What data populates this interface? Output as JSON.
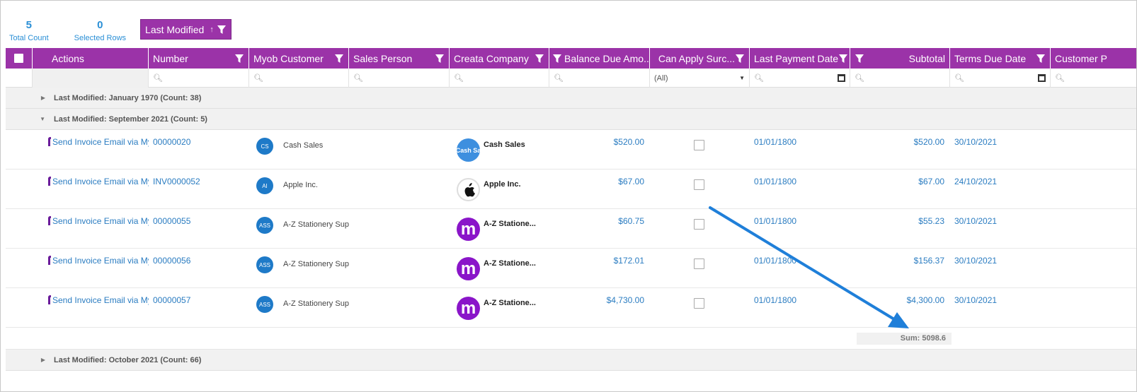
{
  "stats": {
    "total_count": "5",
    "total_count_label": "Total Count",
    "selected_rows": "0",
    "selected_rows_label": "Selected Rows"
  },
  "group_chip": {
    "label": "Last Modified",
    "sort_arrow": "↑"
  },
  "columns": {
    "actions": "Actions",
    "number": "Number",
    "myob_customer": "Myob Customer",
    "sales_person": "Sales Person",
    "creata_company": "Creata Company",
    "balance_due": "Balance Due Amo...",
    "can_apply": "Can Apply Surc...",
    "last_payment": "Last Payment Date",
    "subtotal": "Subtotal",
    "terms_due": "Terms Due Date",
    "customer_p": "Customer P"
  },
  "filters": {
    "can_apply_value": "(All)"
  },
  "groups": {
    "g1970": "Last Modified: January 1970 (Count: 38)",
    "g2021sep": "Last Modified: September 2021 (Count: 5)",
    "g2021oct": "Last Modified: October 2021 (Count: 66)"
  },
  "rows": [
    {
      "action": "Send Invoice Email via My",
      "number": "00000020",
      "cust_initials": "CS",
      "customer": "Cash Sales",
      "company_logo": "Cash Sa",
      "company": "Cash Sales",
      "balance": "$520.00",
      "last_payment": "01/01/1800",
      "subtotal": "$520.00",
      "terms_due": "30/10/2021"
    },
    {
      "action": "Send Invoice Email via My",
      "number": "INV0000052",
      "cust_initials": "AI",
      "customer": "Apple Inc.",
      "company_logo": "",
      "company": "Apple Inc.",
      "balance": "$67.00",
      "last_payment": "01/01/1800",
      "subtotal": "$67.00",
      "terms_due": "24/10/2021"
    },
    {
      "action": "Send Invoice Email via My",
      "number": "00000055",
      "cust_initials": "ASS",
      "customer": "A-Z Stationery Supp",
      "company_logo": "m",
      "company": "A-Z Statione...",
      "balance": "$60.75",
      "last_payment": "01/01/1800",
      "subtotal": "$55.23",
      "terms_due": "30/10/2021"
    },
    {
      "action": "Send Invoice Email via My",
      "number": "00000056",
      "cust_initials": "ASS",
      "customer": "A-Z Stationery Supp",
      "company_logo": "m",
      "company": "A-Z Statione...",
      "balance": "$172.01",
      "last_payment": "01/01/1800",
      "subtotal": "$156.37",
      "terms_due": "30/10/2021"
    },
    {
      "action": "Send Invoice Email via My",
      "number": "00000057",
      "cust_initials": "ASS",
      "customer": "A-Z Stationery Supp",
      "company_logo": "m",
      "company": "A-Z Statione...",
      "balance": "$4,730.00",
      "last_payment": "01/01/1800",
      "subtotal": "$4,300.00",
      "terms_due": "30/10/2021"
    }
  ],
  "summary": {
    "subtotal_sum": "Sum: 5098.6"
  },
  "colors": {
    "header": "#9b33a8",
    "link": "#2a7cc1",
    "annotation_arrow": "#1f7fd9"
  }
}
